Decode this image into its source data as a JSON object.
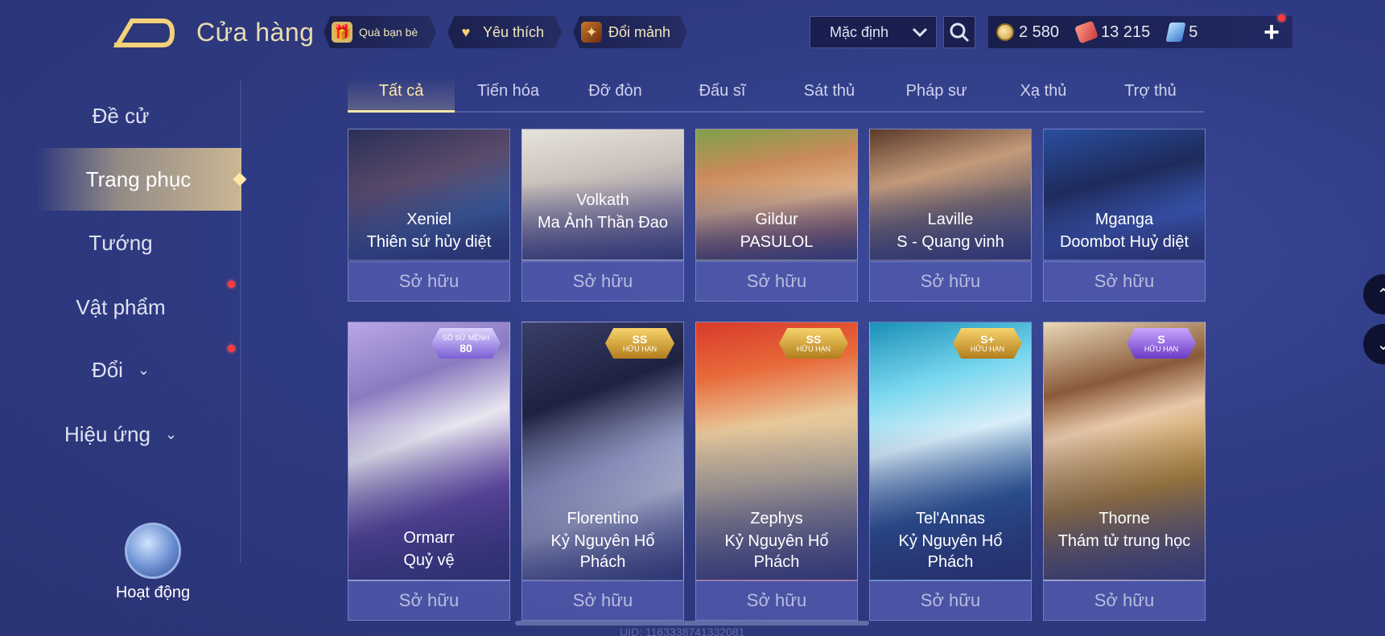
{
  "header": {
    "title": "Cửa hàng",
    "buttons": [
      {
        "label": "Quà bạn bè",
        "icon": "gift-icon"
      },
      {
        "label": "Yêu thích",
        "icon": "heart-icon"
      },
      {
        "label": "Đổi mảnh",
        "icon": "fragment-icon"
      }
    ],
    "sort_label": "Mặc định",
    "currencies": [
      {
        "value": "2 580",
        "icon": "gold-coin-icon"
      },
      {
        "value": "13 215",
        "icon": "voucher-icon"
      },
      {
        "value": "5",
        "icon": "gem-icon"
      }
    ],
    "plus": "+"
  },
  "sidebar": {
    "items": [
      {
        "label": "Đề cử",
        "active": false,
        "dot": false,
        "chevron": false
      },
      {
        "label": "Trang phục",
        "active": true,
        "dot": false,
        "chevron": false
      },
      {
        "label": "Tướng",
        "active": false,
        "dot": false,
        "chevron": false
      },
      {
        "label": "Vật phẩm",
        "active": false,
        "dot": true,
        "chevron": false
      },
      {
        "label": "Đổi",
        "active": false,
        "dot": true,
        "chevron": true
      },
      {
        "label": "Hiệu ứng",
        "active": false,
        "dot": false,
        "chevron": true
      }
    ],
    "activity_label": "Hoạt động"
  },
  "tabs": [
    {
      "label": "Tất cả",
      "active": true
    },
    {
      "label": "Tiến hóa"
    },
    {
      "label": "Đỡ đòn"
    },
    {
      "label": "Đấu sĩ"
    },
    {
      "label": "Sát thủ"
    },
    {
      "label": "Pháp sư"
    },
    {
      "label": "Xạ thủ"
    },
    {
      "label": "Trợ thủ"
    }
  ],
  "owned_label": "Sở hữu",
  "row1": [
    {
      "hero": "Xeniel",
      "skin": "Thiên sứ hủy diệt"
    },
    {
      "hero": "Volkath",
      "skin": "Ma Ảnh Thần Đao"
    },
    {
      "hero": "Gildur",
      "skin": "PASULOL"
    },
    {
      "hero": "Laville",
      "skin": "S - Quang vinh"
    },
    {
      "hero": "Mganga",
      "skin": "Doombot Huỷ diệt"
    }
  ],
  "row2": [
    {
      "hero": "Ormarr",
      "skin": "Quỷ vệ",
      "badge_top": "80",
      "badge_sub": "SỔ SỨ MỆNH"
    },
    {
      "hero": "Florentino",
      "skin": "Kỷ Nguyên Hổ Phách",
      "badge_top": "SS",
      "badge_sub": "HỮU HẠN"
    },
    {
      "hero": "Zephys",
      "skin": "Kỷ Nguyên Hổ Phách",
      "badge_top": "SS",
      "badge_sub": "HỮU HẠN"
    },
    {
      "hero": "Tel'Annas",
      "skin": "Kỷ Nguyên Hổ Phách",
      "badge_top": "S+",
      "badge_sub": "HỮU HẠN"
    },
    {
      "hero": "Thorne",
      "skin": "Thám tử trung học",
      "badge_top": "S",
      "badge_sub": "HỮU HẠN"
    }
  ],
  "uid": "UID: 1163338741332081",
  "colors": {
    "accent": "#ffe7a6",
    "bg": "#2f3b84",
    "owned_bg": "#5058aa"
  }
}
